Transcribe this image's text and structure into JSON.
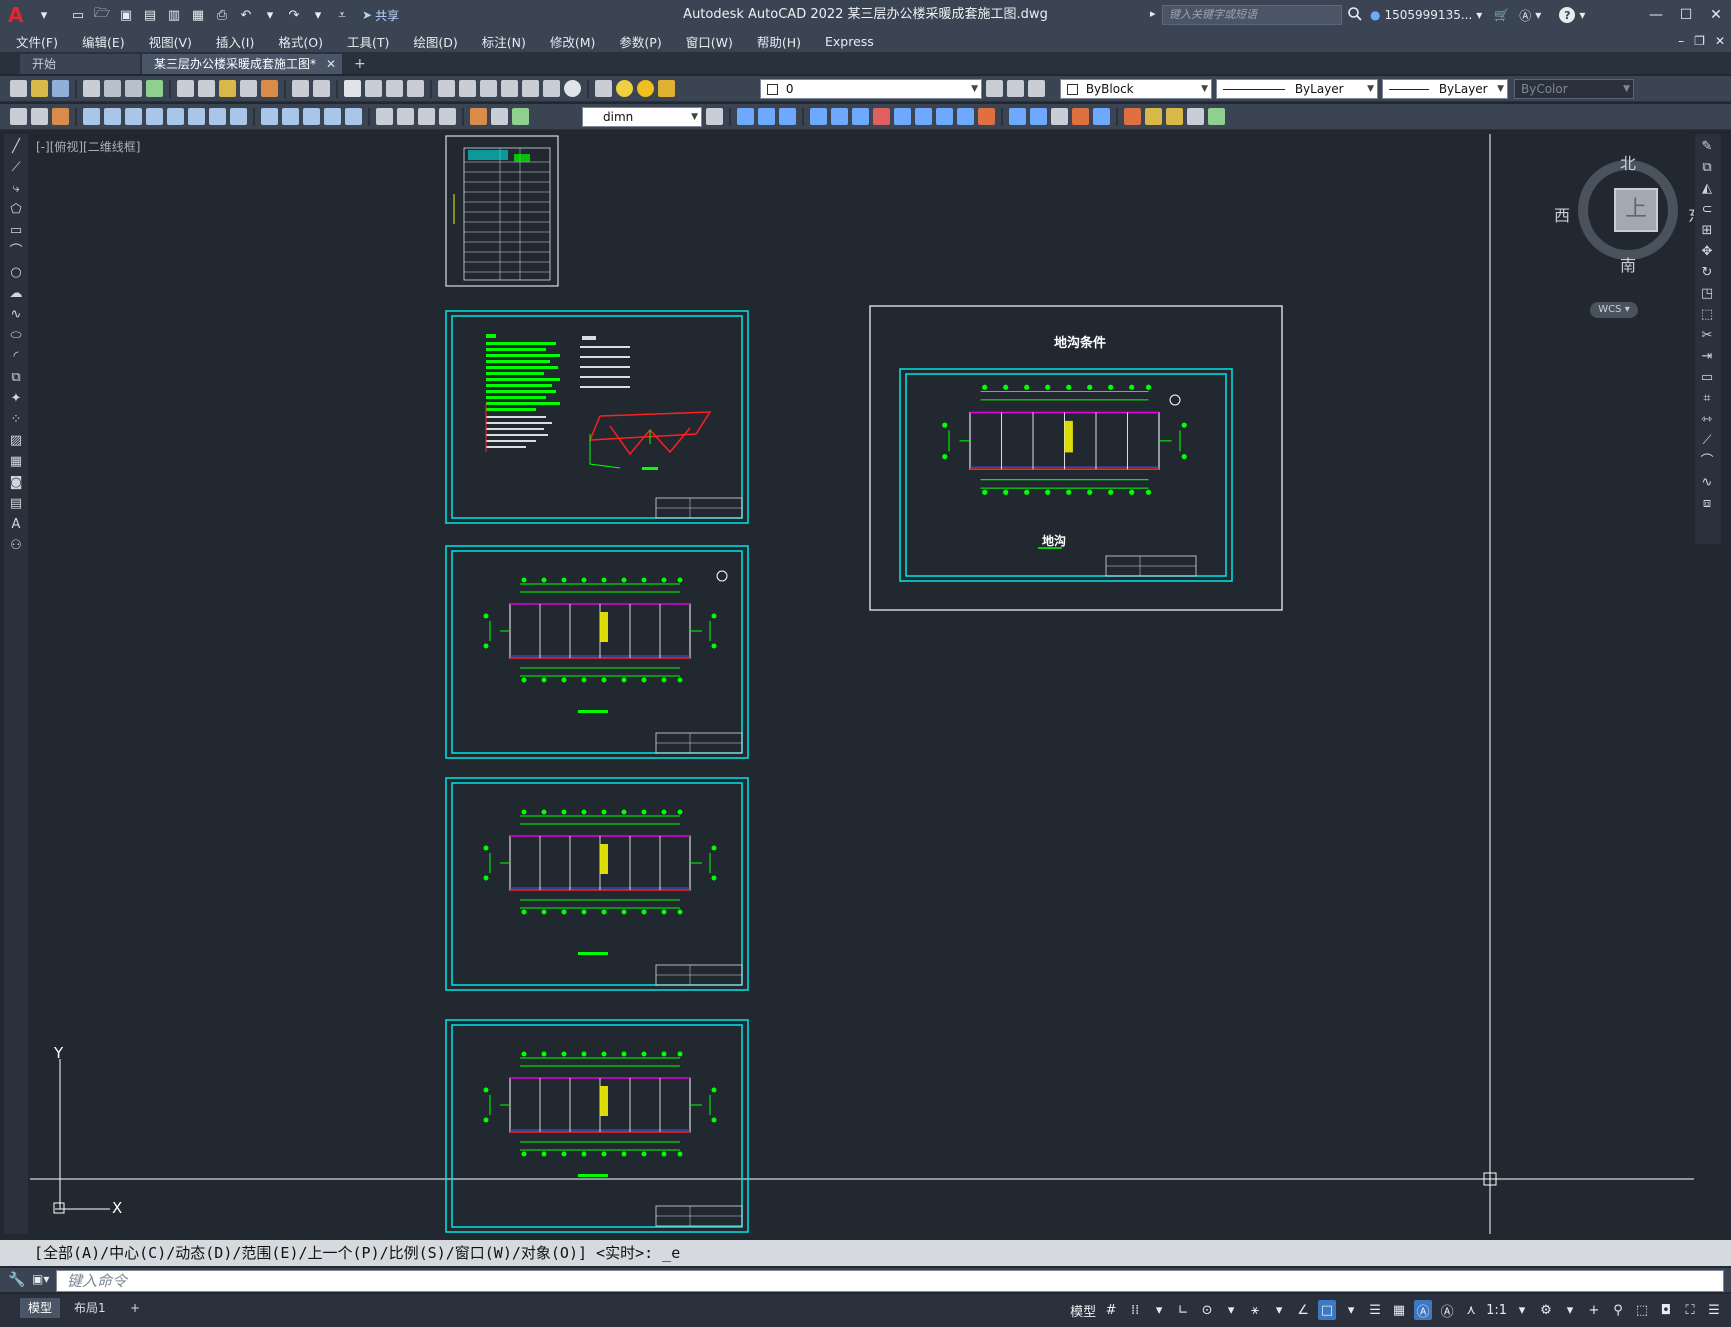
{
  "titlebar": {
    "title": "Autodesk AutoCAD 2022    某三层办公楼采暖成套施工图.dwg",
    "share_label": "共享",
    "search_placeholder": "键入关键字或短语",
    "user_name": "1505999135...",
    "app_letter": "A"
  },
  "menu": {
    "items": [
      "文件(F)",
      "编辑(E)",
      "视图(V)",
      "插入(I)",
      "格式(O)",
      "工具(T)",
      "绘图(D)",
      "标注(N)",
      "修改(M)",
      "参数(P)",
      "窗口(W)",
      "帮助(H)",
      "Express"
    ]
  },
  "tabs": {
    "start_label": "开始",
    "active_label": "某三层办公楼采暖成套施工图*",
    "close_glyph": "✕",
    "add_glyph": "+"
  },
  "toolbar": {
    "layer_value": "0",
    "color_value": "ByBlock",
    "linetype_value": "ByLayer",
    "lineweight_value": "ByLayer",
    "plotstyle_value": "ByColor",
    "dimstyle_value": "dimn"
  },
  "drawing": {
    "view_label": "[-][俯视][二维线框]",
    "viewcube": {
      "north": "北",
      "south": "南",
      "east": "东",
      "west": "西",
      "face": "上",
      "wcs_label": "WCS"
    },
    "ucs": {
      "x_label": "X",
      "y_label": "Y"
    },
    "sheet_title_trench": "地沟条件",
    "sheet_subtitle_trench": "地沟"
  },
  "command": {
    "history": "[全部(A)/中心(C)/动态(D)/范围(E)/上一个(P)/比例(S)/窗口(W)/对象(O)] <实时>: _e",
    "placeholder": "键入命令"
  },
  "statusbar": {
    "model_tab": "模型",
    "layout_tab": "布局1",
    "add_glyph": "+",
    "model_button": "模型",
    "scale_label": "1:1"
  },
  "colors": {
    "background": "#212830",
    "chrome": "#3b4453",
    "sheet_border": "#00e5e5",
    "frame_white": "#ffffff",
    "green": "#00ff00",
    "magenta": "#e000e0",
    "red": "#ff2020"
  }
}
